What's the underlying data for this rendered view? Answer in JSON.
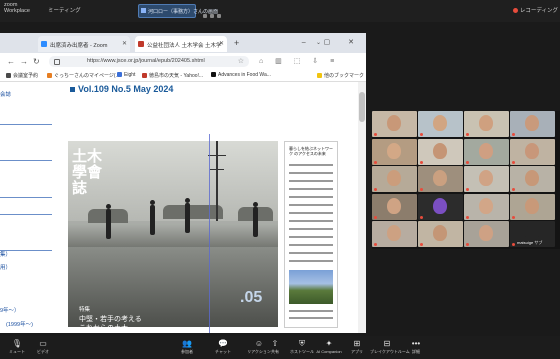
{
  "topbar": {
    "app_name_line1": "zoom",
    "app_name_line2": "Workplace",
    "meeting_title": "ミーティング",
    "share_chip": "河口ロー（事務方）さんの画面",
    "recording_label": "レコーディング"
  },
  "browser": {
    "tabs": [
      {
        "label": "出席済み出席者 - Zoom"
      },
      {
        "label": "公益社団法人 土木学会 土木学"
      }
    ],
    "new_tab": "+",
    "window_controls": "–  ▢  ✕",
    "url": "https://www.jsce.or.jp/journal/epub/202405.shtml",
    "bookmarks": [
      {
        "label": "会議室予約",
        "color": "#4a4a4a"
      },
      {
        "label": "ぐっちーさんのマイページ(...",
        "color": "#e67e22"
      },
      {
        "label": "Eight",
        "color": "#3a6fd8"
      },
      {
        "label": "徳島市の天気 - Yahoo!...",
        "color": "#c0392b"
      },
      {
        "label": "Advances in Food Wa...",
        "color": "#111111"
      },
      {
        "label": "他のブックマーク",
        "color": "#f1c40f"
      }
    ]
  },
  "page": {
    "side_links": [
      "会誌",
      "集）",
      "用）",
      "9年〜）",
      "(1999年〜)"
    ],
    "volume_title": "Vol.109 No.5 May 2024",
    "cover": {
      "masthead": "土木學會誌",
      "subtitle_line1": "特集",
      "subtitle_line2": "中堅・若手の考える",
      "subtitle_line3": "これからの土木",
      "issue_number": ".05"
    },
    "back_cover_title": "暮らしを結ぶネットワーク のアクセスの未来"
  },
  "gallery": {
    "tiles": [
      {
        "name": "",
        "bg": "#c6b8a6",
        "face": "#c89878"
      },
      {
        "name": "",
        "bg": "#b7c2c9",
        "face": "#d1a582"
      },
      {
        "name": "",
        "bg": "#c9c2b2",
        "face": "#cfa07f"
      },
      {
        "name": "",
        "bg": "#a8b0b8",
        "face": "#c99a7c"
      },
      {
        "name": "",
        "bg": "#b49c82",
        "face": "#d3a886"
      },
      {
        "name": "",
        "bg": "#cfc8bb",
        "face": "#c59575"
      },
      {
        "name": "",
        "bg": "#a3a99f",
        "face": "#cf9f82"
      },
      {
        "name": "",
        "bg": "#bfb3a2",
        "face": "#c8977a"
      },
      {
        "name": "",
        "bg": "#b6aa98",
        "face": "#cb9d7c"
      },
      {
        "name": "",
        "bg": "#9e8f7d",
        "face": "#caa080"
      },
      {
        "name": "",
        "bg": "#c4c0b5",
        "face": "#d0a385"
      },
      {
        "name": "",
        "bg": "#b8b2a6",
        "face": "#c79878"
      },
      {
        "name": "",
        "bg": "#8c7d6c",
        "face": "#cfa384"
      },
      {
        "name": "",
        "bg": "#2c2c2c",
        "face": "#7b4fc2"
      },
      {
        "name": "",
        "bg": "#b9b4aa",
        "face": "#d2a688"
      },
      {
        "name": "",
        "bg": "#aea594",
        "face": "#c89979"
      },
      {
        "name": "",
        "bg": "#b7aca0",
        "face": "#cda182"
      },
      {
        "name": "",
        "bg": "#c1b5a3",
        "face": "#c49676"
      },
      {
        "name": "",
        "bg": "#a8a298",
        "face": "#cea184"
      },
      {
        "name": "matsuige サブ",
        "bg": "#262626",
        "face": "#262626"
      }
    ]
  },
  "bottombar": {
    "items": [
      {
        "label": "ミュート",
        "icon": "🎙"
      },
      {
        "label": "ビデオ",
        "icon": "▭"
      },
      {
        "label": "参加者",
        "icon": "👥"
      },
      {
        "label": "チャット",
        "icon": "💬"
      },
      {
        "label": "リアクション",
        "icon": "☺"
      },
      {
        "label": "共有",
        "icon": "⇧"
      },
      {
        "label": "ホストツール",
        "icon": "⛨"
      },
      {
        "label": "AI Companion",
        "icon": "✦"
      },
      {
        "label": "アプリ",
        "icon": "⊞"
      },
      {
        "label": "ブレイクアウトルーム",
        "icon": "⊟"
      },
      {
        "label": "詳細",
        "icon": "•••"
      }
    ]
  }
}
